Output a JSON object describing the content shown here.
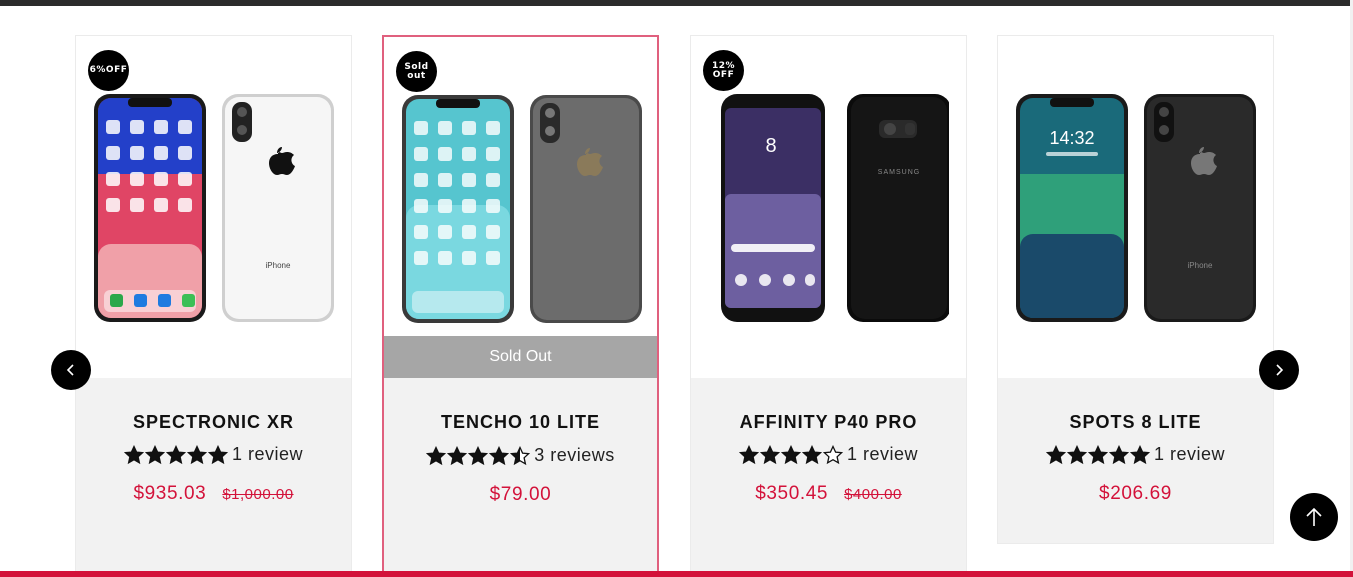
{
  "products": [
    {
      "badge": "6%OFF",
      "name": "SPECTRONIC XR",
      "rating": 5,
      "reviews": "1 review",
      "price": "$935.03",
      "compare_price": "$1,000.00"
    },
    {
      "badge": "Sold out",
      "name": "TENCHO 10 LITE",
      "rating": 4.5,
      "reviews": "3 reviews",
      "price": "$79.00",
      "sold_out_label": "Sold Out"
    },
    {
      "badge": "12% OFF",
      "name": "AFFINITY P40 PRO",
      "rating": 4,
      "reviews": "1 review",
      "price": "$350.45",
      "compare_price": "$400.00"
    },
    {
      "badge": "",
      "name": "SPOTS 8 LITE",
      "rating": 5,
      "reviews": "1 review",
      "price": "$206.69"
    }
  ],
  "phone_labels": {
    "iphone": "iPhone",
    "samsung": "SAMSUNG",
    "lock_time": "14:32",
    "s8_time": "8"
  },
  "colors": {
    "accent": "#d3123a",
    "sold_out_border": "#e0607e",
    "sold_out_bar": "#a6a6a6",
    "card_bg": "#f2f2f2"
  },
  "icons": {
    "prev": "chevron-left-icon",
    "next": "chevron-right-icon",
    "top": "arrow-up-icon"
  }
}
